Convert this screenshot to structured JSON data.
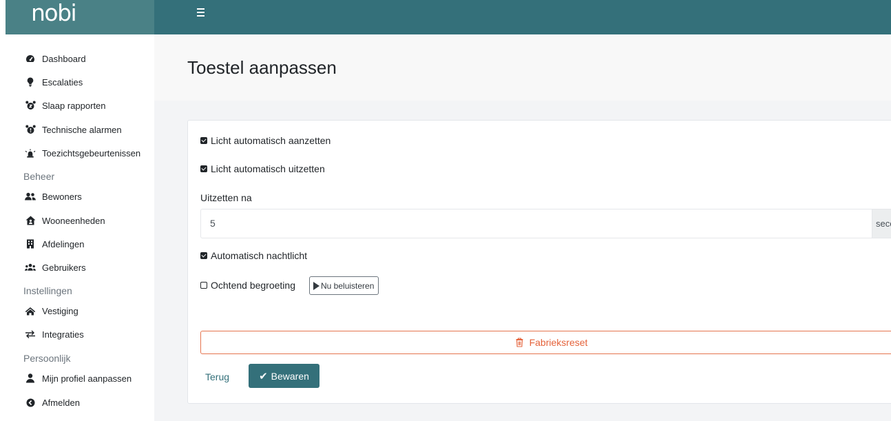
{
  "app": {
    "logo": "nobi"
  },
  "colors": {
    "brand_dark": "#34707a",
    "brand_light": "#4a8186",
    "danger": "#e5633b",
    "content_bg": "#f3f4f6"
  },
  "topbar": {
    "menu_icon": "hamburger-icon"
  },
  "sidebar": {
    "main_items": [
      {
        "label": "Dashboard",
        "icon": "tachometer-icon"
      },
      {
        "label": "Escalaties",
        "icon": "lightbulb-icon"
      },
      {
        "label": "Slaap rapporten",
        "icon": "alarm-clock-icon"
      },
      {
        "label": "Technische alarmen",
        "icon": "alarm-clock-exclamation-icon"
      },
      {
        "label": "Toezichtsgebeurtenissen",
        "icon": "siren-icon"
      }
    ],
    "sections": [
      {
        "heading": "Beheer",
        "items": [
          {
            "label": "Bewoners",
            "icon": "user-friends-icon"
          },
          {
            "label": "Wooneenheden",
            "icon": "house-user-icon"
          },
          {
            "label": "Afdelingen",
            "icon": "building-icon"
          },
          {
            "label": "Gebruikers",
            "icon": "users-icon"
          }
        ]
      },
      {
        "heading": "Instellingen",
        "items": [
          {
            "label": "Vestiging",
            "icon": "home-icon"
          },
          {
            "label": "Integraties",
            "icon": "exchange-icon"
          }
        ]
      },
      {
        "heading": "Persoonlijk",
        "items": [
          {
            "label": "Mijn profiel aanpassen",
            "icon": "user-icon"
          },
          {
            "label": "Afmelden",
            "icon": "arrow-circle-left-icon"
          }
        ]
      }
    ]
  },
  "page": {
    "title": "Toestel aanpassen"
  },
  "form": {
    "light_auto_on": {
      "label": "Licht automatisch aanzetten",
      "checked": true
    },
    "light_auto_off": {
      "label": "Licht automatisch uitzetten",
      "checked": true
    },
    "turn_off_after": {
      "label": "Uitzetten na",
      "value": "5",
      "unit": "seconden"
    },
    "night_light": {
      "label": "Automatisch nachtlicht",
      "checked": true
    },
    "morning_greeting": {
      "label": "Ochtend begroeting",
      "checked": false,
      "listen_label": "Nu beluisteren"
    },
    "factory_reset_label": "Fabrieksreset",
    "back_label": "Terug",
    "save_label": "Bewaren"
  }
}
